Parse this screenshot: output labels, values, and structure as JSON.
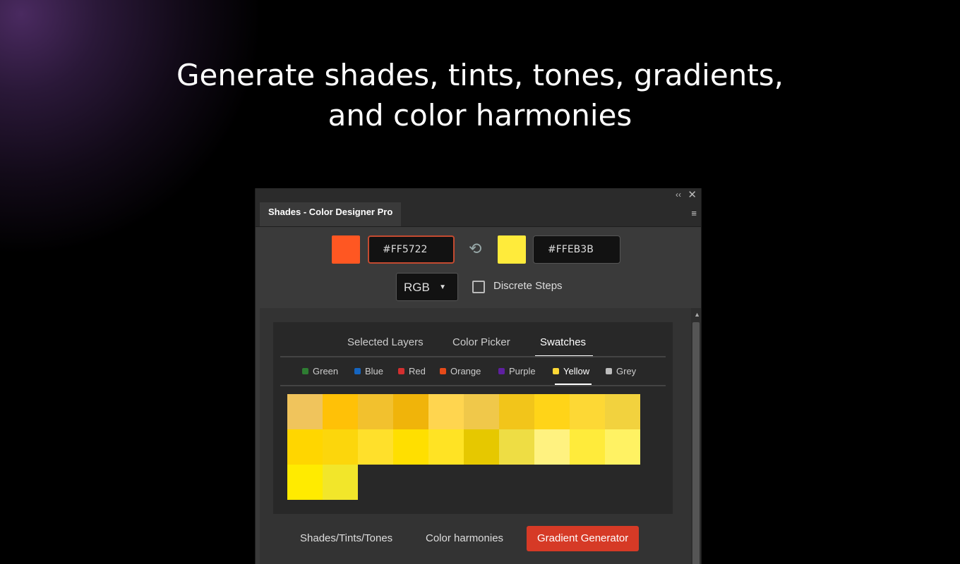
{
  "headline": {
    "line1": "Generate shades, tints, tones, gradients,",
    "line2": "and color harmonies"
  },
  "window": {
    "title": "Shades - Color Designer Pro",
    "collapse_icon": "double-chevron-left-icon",
    "close_icon": "close-icon",
    "menu_icon": "hamburger-menu-icon"
  },
  "colors": {
    "start": {
      "hex": "#FF5722",
      "swatch": "#FF5722"
    },
    "end": {
      "hex": "#FFEB3B",
      "swatch": "#FFEB3B"
    },
    "swap_icon": "swap-arrows-icon"
  },
  "mode": {
    "selected": "RGB"
  },
  "discrete_steps": {
    "label": "Discrete Steps",
    "checked": false
  },
  "source_tabs": [
    {
      "label": "Selected Layers",
      "active": false
    },
    {
      "label": "Color Picker",
      "active": false
    },
    {
      "label": "Swatches",
      "active": true
    }
  ],
  "categories": [
    {
      "label": "Green",
      "color": "#2e7d32",
      "active": false
    },
    {
      "label": "Blue",
      "color": "#1565c0",
      "active": false
    },
    {
      "label": "Red",
      "color": "#d32f2f",
      "active": false
    },
    {
      "label": "Orange",
      "color": "#e64a19",
      "active": false
    },
    {
      "label": "Purple",
      "color": "#5e1fa0",
      "active": false
    },
    {
      "label": "Yellow",
      "color": "#fdd835",
      "active": true
    },
    {
      "label": "Grey",
      "color": "#bdbdbd",
      "active": false
    }
  ],
  "swatches": [
    "#F0C45C",
    "#FFC107",
    "#F2C12E",
    "#F0B40A",
    "#FFD54F",
    "#F0C84A",
    "#F2C51A",
    "#FFD418",
    "#FDD835",
    "#F2D23E",
    "#FFD600",
    "#FCD60C",
    "#FFE02B",
    "#FFDF00",
    "#FFE324",
    "#E6C800",
    "#EEDD44",
    "#FFF280",
    "#FFEB3B",
    "#FFF263",
    "#FFEB00",
    "#F2E62A"
  ],
  "bottom_tabs": [
    {
      "label": "Shades/Tints/Tones",
      "active": false
    },
    {
      "label": "Color harmonies",
      "active": false
    },
    {
      "label": "Gradient Generator",
      "active": true
    }
  ]
}
